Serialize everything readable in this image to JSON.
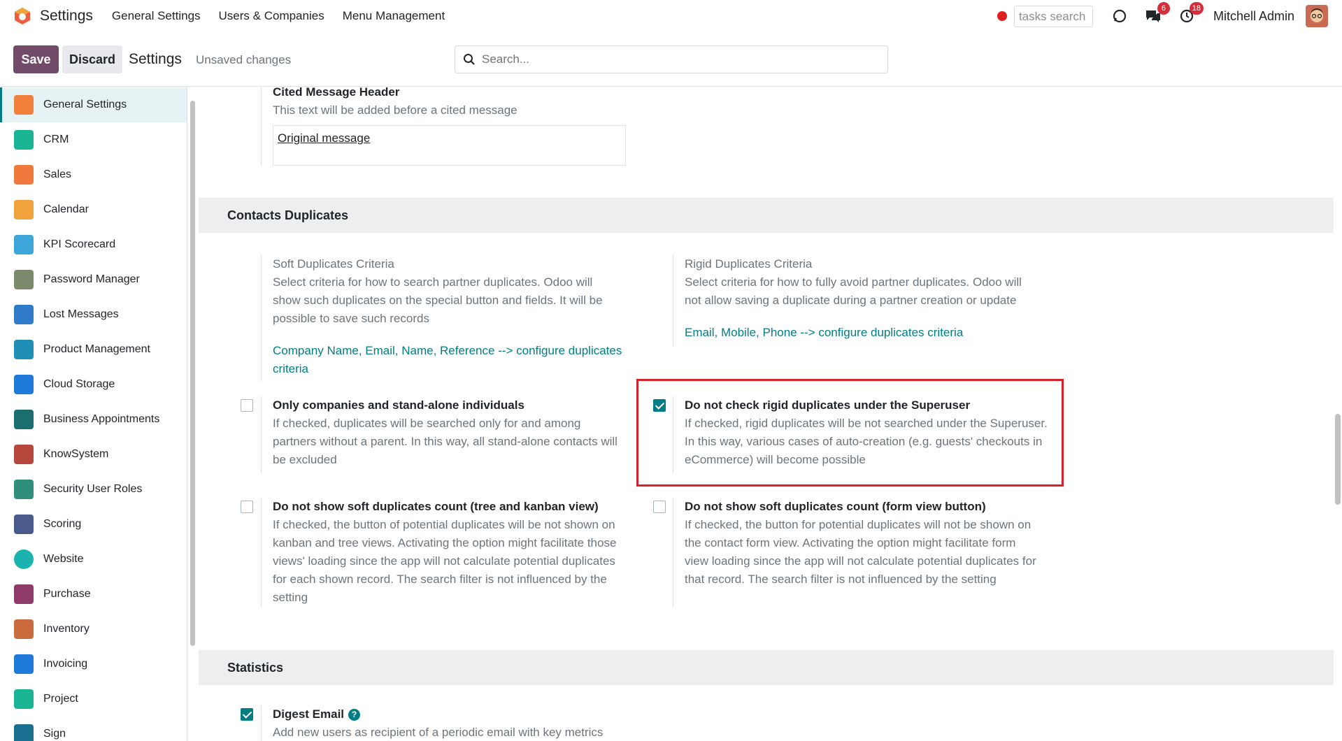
{
  "topbar": {
    "app_title": "Settings",
    "menu": [
      "General Settings",
      "Users & Companies",
      "Menu Management"
    ],
    "tasks_search_placeholder": "tasks search",
    "messages_badge": "6",
    "activities_badge": "18",
    "user_name": "Mitchell Admin"
  },
  "control_panel": {
    "save_label": "Save",
    "discard_label": "Discard",
    "title": "Settings",
    "unsaved": "Unsaved changes",
    "search_placeholder": "Search..."
  },
  "sidebar": {
    "items": [
      {
        "label": "General Settings",
        "icon": "general-settings-icon",
        "color": "#f0803c"
      },
      {
        "label": "CRM",
        "icon": "crm-icon",
        "color": "#1ab394"
      },
      {
        "label": "Sales",
        "icon": "sales-icon",
        "color": "#f07a3c"
      },
      {
        "label": "Calendar",
        "icon": "calendar-icon",
        "color": "#f0a23c"
      },
      {
        "label": "KPI Scorecard",
        "icon": "kpi-scorecard-icon",
        "color": "#3ca6d8"
      },
      {
        "label": "Password Manager",
        "icon": "password-manager-icon",
        "color": "#7a8a6a"
      },
      {
        "label": "Lost Messages",
        "icon": "lost-messages-icon",
        "color": "#2f7bc9"
      },
      {
        "label": "Product Management",
        "icon": "product-management-icon",
        "color": "#1e8fb5"
      },
      {
        "label": "Cloud Storage",
        "icon": "cloud-storage-icon",
        "color": "#1e7ad8"
      },
      {
        "label": "Business Appointments",
        "icon": "business-appointments-icon",
        "color": "#1a6e6e"
      },
      {
        "label": "KnowSystem",
        "icon": "knowsystem-icon",
        "color": "#b5473c"
      },
      {
        "label": "Security User Roles",
        "icon": "security-user-roles-icon",
        "color": "#2f8f7b"
      },
      {
        "label": "Scoring",
        "icon": "scoring-icon",
        "color": "#4a5a8a"
      },
      {
        "label": "Website",
        "icon": "website-icon",
        "color": "#1ab3b0"
      },
      {
        "label": "Purchase",
        "icon": "purchase-icon",
        "color": "#8e3a6b"
      },
      {
        "label": "Inventory",
        "icon": "inventory-icon",
        "color": "#c96b3c"
      },
      {
        "label": "Invoicing",
        "icon": "invoicing-icon",
        "color": "#1e7ad8"
      },
      {
        "label": "Project",
        "icon": "project-icon",
        "color": "#1ab394"
      },
      {
        "label": "Sign",
        "icon": "sign-icon",
        "color": "#1a6e8e"
      }
    ]
  },
  "content": {
    "cited_header_partial": "Cited Message Header",
    "cited_desc": "This text will be added before a cited message",
    "cited_value": "Original message",
    "contacts_duplicates_title": "Contacts Duplicates",
    "soft_criteria_label": "Soft Duplicates Criteria",
    "soft_criteria_desc": "Select criteria for how to search partner duplicates. Odoo will show such duplicates on the special button and fields. It will be possible to save such records",
    "soft_criteria_link": "Company Name, Email, Name, Reference --> configure duplicates criteria",
    "rigid_criteria_label": "Rigid Duplicates Criteria",
    "rigid_criteria_desc": "Select criteria for how to fully avoid partner duplicates. Odoo will not allow saving a duplicate during a partner creation or update",
    "rigid_criteria_link": "Email, Mobile, Phone --> configure duplicates criteria",
    "only_companies_label": "Only companies and stand-alone individuals",
    "only_companies_desc": "If checked, duplicates will be searched only for and among partners without a parent. In this way, all stand-alone contacts will be excluded",
    "only_companies_checked": false,
    "superuser_label": "Do not check rigid duplicates under the Superuser",
    "superuser_desc": "If checked, rigid duplicates will be not searched under the Superuser. In this way, various cases of auto-creation (e.g. guests' checkouts in eCommerce) will become possible",
    "superuser_checked": true,
    "soft_tree_label": "Do not show soft duplicates count (tree and kanban view)",
    "soft_tree_desc": "If checked, the button of potential duplicates will be not shown on kanban and tree views. Activating the option might facilitate those views' loading since the app will not calculate potential duplicates for each shown record. The search filter is not influenced by the setting",
    "soft_tree_checked": false,
    "soft_form_label": "Do not show soft duplicates count (form view button)",
    "soft_form_desc": "If checked, the button for potential duplicates will not be shown on the contact form view. Activating the option might facilitate form view loading since the app will not calculate potential duplicates for that record. The search filter is not influenced by the setting",
    "soft_form_checked": false,
    "statistics_title": "Statistics",
    "digest_label": "Digest Email",
    "digest_help": "?",
    "digest_desc": "Add new users as recipient of a periodic email with key metrics",
    "digest_checked": true
  },
  "colors": {
    "brand": "#714b67",
    "accent": "#017e84",
    "highlight": "#d8222b"
  }
}
